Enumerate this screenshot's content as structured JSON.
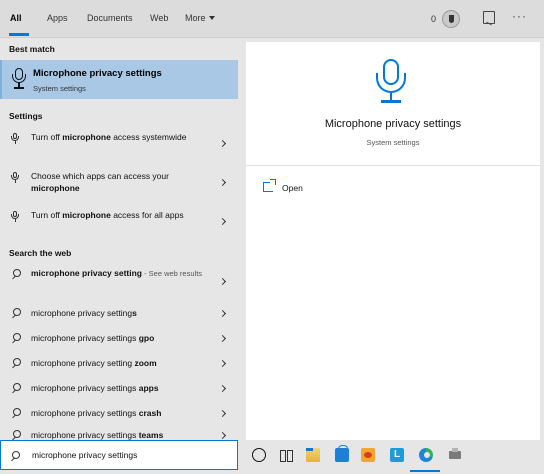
{
  "tabs": {
    "all": "All",
    "apps": "Apps",
    "documents": "Documents",
    "web": "Web",
    "more": "More"
  },
  "header": {
    "points": "0"
  },
  "left": {
    "best_match_title": "Best match",
    "best_match": {
      "name": "Microphone privacy settings",
      "subtitle": "System settings"
    },
    "settings_title": "Settings",
    "settings": [
      {
        "pre": "Turn off ",
        "bold": "microphone",
        "post": " access systemwide"
      },
      {
        "pre": "Choose which apps can access your ",
        "bold": "microphone",
        "post": ""
      },
      {
        "pre": "Turn off ",
        "bold": "microphone",
        "post": " access for all apps"
      }
    ],
    "web_title": "Search the web",
    "web_first": {
      "text": "microphone privacy setting",
      "hint": " - See web results"
    },
    "web": [
      {
        "pre": "microphone privacy setting",
        "bold": "s"
      },
      {
        "pre": "microphone privacy settings",
        "bold": " gpo"
      },
      {
        "pre": "microphone privacy setting",
        "bold": " zoom"
      },
      {
        "pre": "microphone privacy settings",
        "bold": " apps"
      },
      {
        "pre": "microphone privacy settings",
        "bold": " crash"
      },
      {
        "pre": "microphone privacy settings",
        "bold": " teams"
      }
    ]
  },
  "right": {
    "title": "Microphone privacy settings",
    "subtitle": "System settings",
    "open_label": "Open"
  },
  "search": {
    "value": "microphone privacy settings"
  },
  "taskbar": {
    "lapp_letter": "L"
  },
  "colors": {
    "accent": "#0078d7",
    "selected_bg": "#a8c8e6",
    "panel_bg": "#e6e6e6"
  }
}
